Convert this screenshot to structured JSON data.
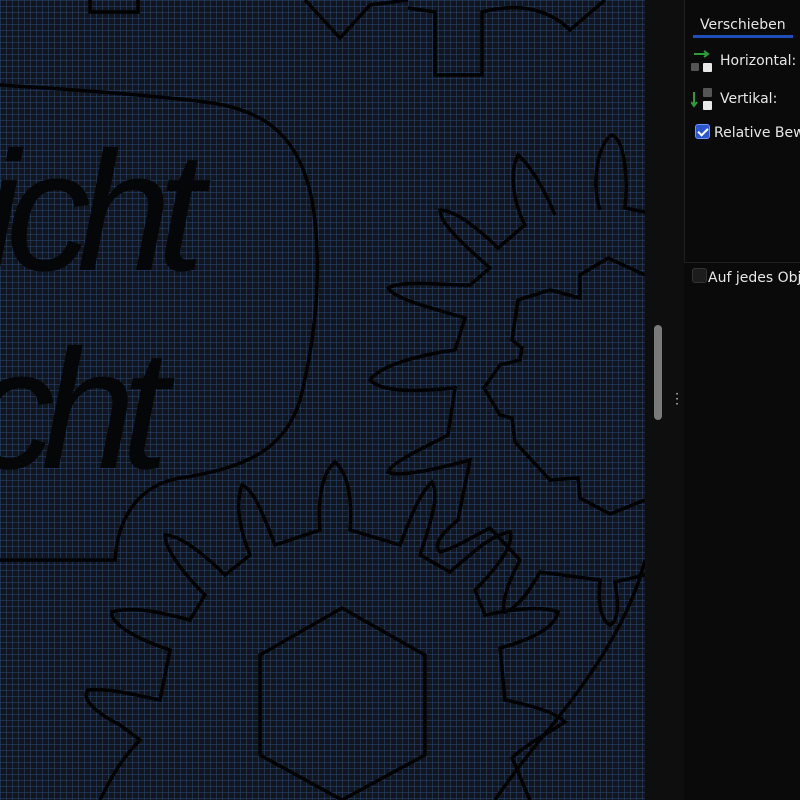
{
  "panel": {
    "tab_label": "Verschieben",
    "horizontal_label": "Horizontal:",
    "vertical_label": "Vertikal:",
    "relative_label": "Relative Bewe",
    "relative_checked": true,
    "each_object_label": "Auf jedes Obje",
    "each_object_checked": false
  },
  "canvas": {
    "text_line_1": "icht",
    "text_line_2": "cht"
  },
  "colors": {
    "canvas_bg": "#12161c",
    "grid": "#284673",
    "accent": "#1e4fb8",
    "arrow_green": "#2e9b3a"
  }
}
